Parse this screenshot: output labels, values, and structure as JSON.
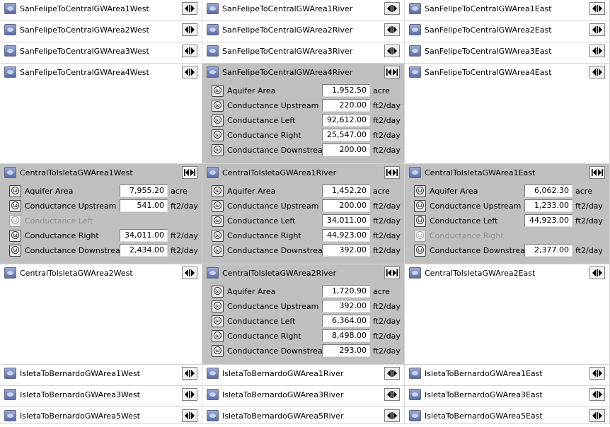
{
  "rows": [
    {
      "cells": [
        {
          "name": "SanFelipeToCentralGWArea1West",
          "expanded": false,
          "slots": []
        },
        {
          "name": "SanFelipeToCentralGWArea1River",
          "expanded": false,
          "slots": []
        },
        {
          "name": "SanFelipeToCentralGWArea1East",
          "expanded": false,
          "slots": []
        }
      ]
    },
    {
      "cells": [
        {
          "name": "SanFelipeToCentralGWArea2West",
          "expanded": false,
          "slots": []
        },
        {
          "name": "SanFelipeToCentralGWArea2River",
          "expanded": false,
          "slots": []
        },
        {
          "name": "SanFelipeToCentralGWArea2East",
          "expanded": false,
          "slots": []
        }
      ]
    },
    {
      "cells": [
        {
          "name": "SanFelipeToCentralGWArea3West",
          "expanded": false,
          "slots": []
        },
        {
          "name": "SanFelipeToCentralGWArea3River",
          "expanded": false,
          "slots": []
        },
        {
          "name": "SanFelipeToCentralGWArea3East",
          "expanded": false,
          "slots": []
        }
      ]
    },
    {
      "cells": [
        {
          "name": "SanFelipeToCentralGWArea4West",
          "expanded": false,
          "slots": []
        },
        {
          "name": "SanFelipeToCentralGWArea4River",
          "expanded": true,
          "slots": [
            {
              "label": "Aquifer Area",
              "value": "1,952.50",
              "unit": "acre",
              "enabled": true
            },
            {
              "label": "Conductance Upstream",
              "value": "220.00",
              "unit": "ft2/day",
              "enabled": true
            },
            {
              "label": "Conductance Left",
              "value": "92,612.00",
              "unit": "ft2/day",
              "enabled": true
            },
            {
              "label": "Conductance Right",
              "value": "25,547.00",
              "unit": "ft2/day",
              "enabled": true
            },
            {
              "label": "Conductance Downstream",
              "value": "200.00",
              "unit": "ft2/day",
              "enabled": true
            }
          ]
        },
        {
          "name": "SanFelipeToCentralGWArea4East",
          "expanded": false,
          "slots": []
        }
      ]
    },
    {
      "cells": [
        {
          "name": "CentralToIsletaGWArea1West",
          "expanded": true,
          "slots": [
            {
              "label": "Aquifer Area",
              "value": "7,955.20",
              "unit": "acre",
              "enabled": true
            },
            {
              "label": "Conductance Upstream",
              "value": "541.00",
              "unit": "ft2/day",
              "enabled": true
            },
            {
              "label": "Conductance Left",
              "value": "",
              "unit": "",
              "enabled": false
            },
            {
              "label": "Conductance Right",
              "value": "34,011.00",
              "unit": "ft2/day",
              "enabled": true
            },
            {
              "label": "Conductance Downstream",
              "value": "2,434.00",
              "unit": "ft2/day",
              "enabled": true
            }
          ]
        },
        {
          "name": "CentralToIsletaGWArea1River",
          "expanded": true,
          "slots": [
            {
              "label": "Aquifer Area",
              "value": "1,452.20",
              "unit": "acre",
              "enabled": true
            },
            {
              "label": "Conductance Upstream",
              "value": "200.00",
              "unit": "ft2/day",
              "enabled": true
            },
            {
              "label": "Conductance Left",
              "value": "34,011.00",
              "unit": "ft2/day",
              "enabled": true
            },
            {
              "label": "Conductance Right",
              "value": "44,923.00",
              "unit": "ft2/day",
              "enabled": true
            },
            {
              "label": "Conductance Downstream",
              "value": "392.00",
              "unit": "ft2/day",
              "enabled": true
            }
          ]
        },
        {
          "name": "CentralToIsletaGWArea1East",
          "expanded": true,
          "slots": [
            {
              "label": "Aquifer Area",
              "value": "6,062.30",
              "unit": "acre",
              "enabled": true
            },
            {
              "label": "Conductance Upstream",
              "value": "1,233.00",
              "unit": "ft2/day",
              "enabled": true
            },
            {
              "label": "Conductance Left",
              "value": "44,923.00",
              "unit": "ft2/day",
              "enabled": true
            },
            {
              "label": "Conductance Right",
              "value": "",
              "unit": "",
              "enabled": false
            },
            {
              "label": "Conductance Downstream",
              "value": "2,377.00",
              "unit": "ft2/day",
              "enabled": true
            }
          ]
        }
      ]
    },
    {
      "cells": [
        {
          "name": "CentralToIsletaGWArea2West",
          "expanded": false,
          "slots": []
        },
        {
          "name": "CentralToIsletaGWArea2River",
          "expanded": true,
          "slots": [
            {
              "label": "Aquifer Area",
              "value": "1,720.90",
              "unit": "acre",
              "enabled": true
            },
            {
              "label": "Conductance Upstream",
              "value": "392.00",
              "unit": "ft2/day",
              "enabled": true
            },
            {
              "label": "Conductance Left",
              "value": "6,364.00",
              "unit": "ft2/day",
              "enabled": true
            },
            {
              "label": "Conductance Right",
              "value": "8,498.00",
              "unit": "ft2/day",
              "enabled": true
            },
            {
              "label": "Conductance Downstream",
              "value": "293.00",
              "unit": "ft2/day",
              "enabled": true
            }
          ]
        },
        {
          "name": "CentralToIsletaGWArea2East",
          "expanded": false,
          "slots": []
        }
      ]
    },
    {
      "cells": [
        {
          "name": "IsletaToBernardoGWArea1West",
          "expanded": false,
          "slots": []
        },
        {
          "name": "IsletaToBernardoGWArea1River",
          "expanded": false,
          "slots": []
        },
        {
          "name": "IsletaToBernardoGWArea1East",
          "expanded": false,
          "slots": []
        }
      ]
    },
    {
      "cells": [
        {
          "name": "IsletaToBernardoGWArea3West",
          "expanded": false,
          "slots": []
        },
        {
          "name": "IsletaToBernardoGWArea3River",
          "expanded": false,
          "slots": []
        },
        {
          "name": "IsletaToBernardoGWArea3East",
          "expanded": false,
          "slots": []
        }
      ]
    },
    {
      "cells": [
        {
          "name": "IsletaToBernardoGWArea5West",
          "expanded": false,
          "slots": []
        },
        {
          "name": "IsletaToBernardoGWArea5River",
          "expanded": false,
          "slots": []
        },
        {
          "name": "IsletaToBernardoGWArea5East",
          "expanded": false,
          "slots": []
        }
      ]
    }
  ]
}
